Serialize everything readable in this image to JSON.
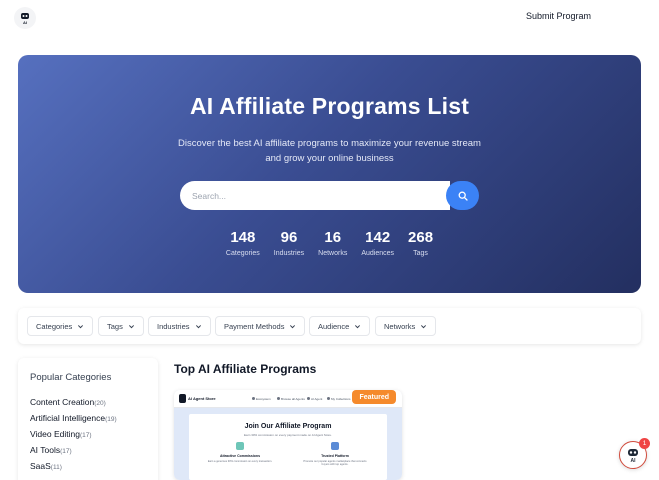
{
  "header": {
    "logo_alt": "AI",
    "submit_label": "Submit Program"
  },
  "hero": {
    "title": "AI Affiliate Programs List",
    "subtitle": "Discover the best AI affiliate programs to maximize your revenue stream and grow your online business",
    "search_placeholder": "Search...",
    "stats": [
      {
        "value": "148",
        "label": "Categories"
      },
      {
        "value": "96",
        "label": "Industries"
      },
      {
        "value": "16",
        "label": "Networks"
      },
      {
        "value": "142",
        "label": "Audiences"
      },
      {
        "value": "268",
        "label": "Tags"
      }
    ]
  },
  "filters": [
    {
      "label": "Categories"
    },
    {
      "label": "Tags"
    },
    {
      "label": "Industries"
    },
    {
      "label": "Payment Methods"
    },
    {
      "label": "Audience"
    },
    {
      "label": "Networks"
    }
  ],
  "sidebar": {
    "title": "Popular Categories",
    "items": [
      {
        "name": "Content Creation",
        "count": "(20)"
      },
      {
        "name": "Artificial Intelligence",
        "count": "(19)"
      },
      {
        "name": "Video Editing",
        "count": "(17)"
      },
      {
        "name": "AI Tools",
        "count": "(17)"
      },
      {
        "name": "SaaS",
        "count": "(11)"
      }
    ]
  },
  "main": {
    "title": "Top AI Affiliate Programs",
    "card": {
      "badge": "Featured",
      "preview": {
        "brand": "AI Agent Store",
        "nav": [
          "Ecosystem",
          "Browse all Agents",
          "AI Agent",
          "My Collections"
        ],
        "heading": "Join Our Affiliate Program",
        "sub": "Earn 30% commission on every payment made on AI Agent Store.",
        "col1_title": "Attractive Commissions",
        "col1_text": "Earn a generous 30% commission on every transaction.",
        "col2_title": "Trusted Platform",
        "col2_text": "Promote our popular agents marketplace that connects buyers with top agents."
      }
    }
  },
  "chat": {
    "badge": "1",
    "label": "AI"
  },
  "colors": {
    "hero_start": "#5670bf",
    "hero_end": "#232f60",
    "accent": "#3b82f6",
    "featured": "#f58a2c",
    "badge": "#ef4444"
  }
}
